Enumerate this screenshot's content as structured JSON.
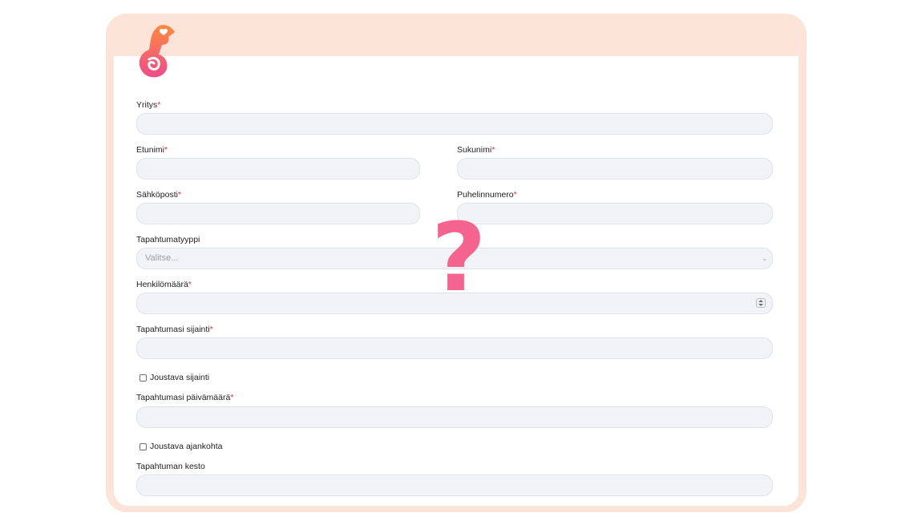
{
  "brand": {
    "logo_icon": "chameleon-logo-icon",
    "accent": "#f4648e",
    "frame_color": "#fde4d8"
  },
  "overlay": {
    "symbol": "?"
  },
  "form": {
    "required_mark": "*",
    "company": {
      "label": "Yritys",
      "value": ""
    },
    "first_name": {
      "label": "Etunimi",
      "value": ""
    },
    "last_name": {
      "label": "Sukunimi",
      "value": ""
    },
    "email": {
      "label": "Sähköposti",
      "value": ""
    },
    "phone": {
      "label": "Puhelinnumero",
      "value": ""
    },
    "event_type": {
      "label": "Tapahtumatyyppi",
      "placeholder": "Valitse..."
    },
    "headcount": {
      "label": "Henkilömäärä",
      "value": ""
    },
    "location": {
      "label": "Tapahtumasi sijainti",
      "value": ""
    },
    "flexible_location": {
      "label": "Joustava sijainti",
      "checked": false
    },
    "date": {
      "label": "Tapahtumasi päivämäärä",
      "value": ""
    },
    "flexible_time": {
      "label": "Joustava ajankohta",
      "checked": false
    },
    "duration": {
      "label": "Tapahtuman kesto",
      "value": ""
    }
  }
}
